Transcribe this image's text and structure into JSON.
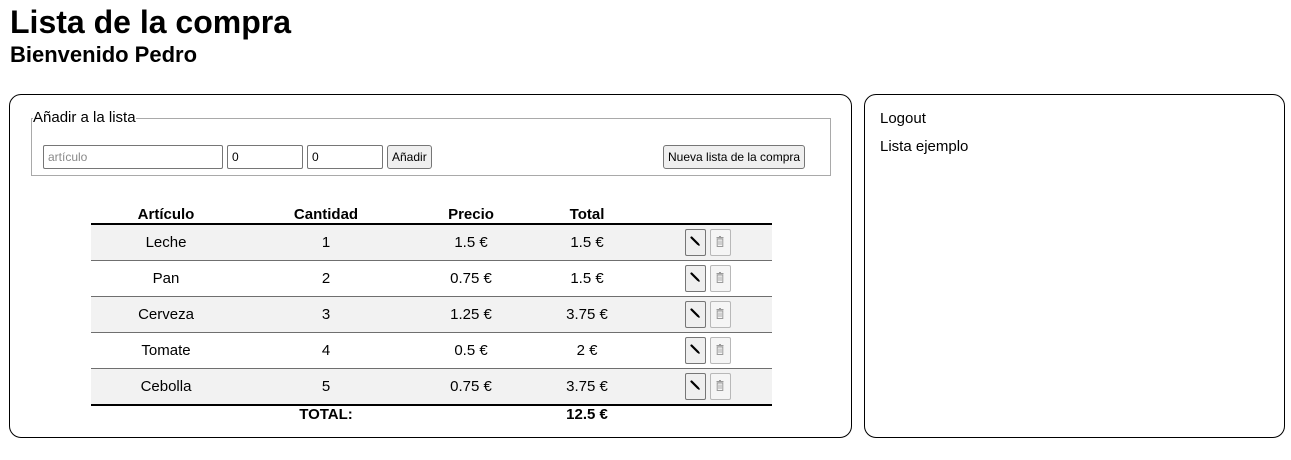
{
  "header": {
    "title": "Lista de la compra",
    "welcome": "Bienvenido Pedro"
  },
  "add_form": {
    "legend": "Añadir a la lista",
    "item_placeholder": "artículo",
    "quantity_value": "0",
    "price_value": "0",
    "add_button": "Añadir",
    "new_list_button": "Nueva lista de la compra"
  },
  "table": {
    "headers": [
      "Artículo",
      "Cantidad",
      "Precio",
      "Total"
    ],
    "rows": [
      {
        "item": "Leche",
        "qty": "1",
        "price": "1.5 €",
        "total": "1.5 €"
      },
      {
        "item": "Pan",
        "qty": "2",
        "price": "0.75 €",
        "total": "1.5 €"
      },
      {
        "item": "Cerveza",
        "qty": "3",
        "price": "1.25 €",
        "total": "3.75 €"
      },
      {
        "item": "Tomate",
        "qty": "4",
        "price": "0.5 €",
        "total": "2 €"
      },
      {
        "item": "Cebolla",
        "qty": "5",
        "price": "0.75 €",
        "total": "3.75 €"
      }
    ],
    "total_label": "TOTAL:",
    "total_value": "12.5 €",
    "edit_icon": "brush-icon",
    "delete_icon": "trash-icon"
  },
  "sidebar": {
    "logout": "Logout",
    "lists": [
      "Lista ejemplo"
    ]
  }
}
